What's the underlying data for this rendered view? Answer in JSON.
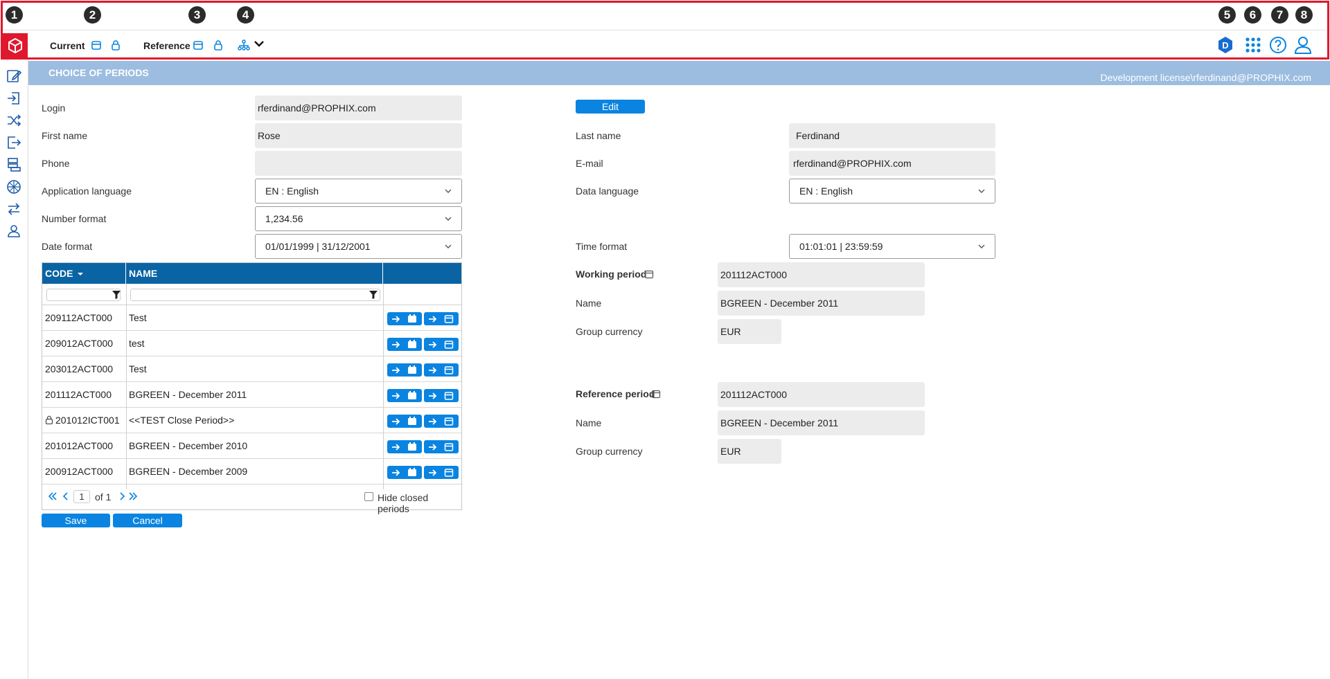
{
  "callouts": [
    "1",
    "2",
    "3",
    "4",
    "5",
    "6",
    "7",
    "8"
  ],
  "header": {
    "current_label": "Current",
    "reference_label": "Reference"
  },
  "banner": {
    "title": "CHOICE OF PERIODS",
    "license": "Development license\\rferdinand@PROPHIX.com"
  },
  "form": {
    "login_label": "Login",
    "login_value": "rferdinand@PROPHIX.com",
    "first_name_label": "First name",
    "first_name_value": "Rose",
    "phone_label": "Phone",
    "phone_value": "",
    "app_lang_label": "Application language",
    "app_lang_value": "EN : English",
    "number_format_label": "Number format",
    "number_format_value": "1,234.56",
    "date_format_label": "Date format",
    "date_format_value": "01/01/1999 | 31/12/2001",
    "edit_button": "Edit",
    "last_name_label": "Last name",
    "last_name_value": "Ferdinand",
    "email_label": "E-mail",
    "email_value": "rferdinand@PROPHIX.com",
    "data_lang_label": "Data language",
    "data_lang_value": "EN : English",
    "time_format_label": "Time format",
    "time_format_value": "01:01:01 | 23:59:59"
  },
  "working": {
    "label": "Working period",
    "value": "201112ACT000",
    "name_label": "Name",
    "name_value": "BGREEN - December 2011",
    "currency_label": "Group currency",
    "currency_value": "EUR"
  },
  "reference": {
    "label": "Reference period",
    "value": "201112ACT000",
    "name_label": "Name",
    "name_value": "BGREEN - December 2011",
    "currency_label": "Group currency",
    "currency_value": "EUR"
  },
  "table": {
    "col_code": "CODE",
    "col_name": "NAME",
    "rows": [
      {
        "code": "209112ACT000",
        "name": "Test",
        "locked": false
      },
      {
        "code": "209012ACT000",
        "name": "test",
        "locked": false
      },
      {
        "code": "203012ACT000",
        "name": "Test",
        "locked": false
      },
      {
        "code": "201112ACT000",
        "name": "BGREEN - December 2011",
        "locked": false
      },
      {
        "code": "201012ICT001",
        "name": "<<TEST Close Period>>",
        "locked": true
      },
      {
        "code": "201012ACT000",
        "name": "BGREEN - December 2010",
        "locked": false
      },
      {
        "code": "200912ACT000",
        "name": "BGREEN - December 2009",
        "locked": false
      }
    ],
    "pager": {
      "page": "1",
      "of_label": "of 1"
    },
    "hide_closed_label": "Hide closed periods"
  },
  "actions": {
    "save": "Save",
    "cancel": "Cancel"
  },
  "colors": {
    "accent": "#0a84e0",
    "header_blue": "#0a63a3",
    "banner": "#9cbde0",
    "brand_red": "#e0182d"
  }
}
